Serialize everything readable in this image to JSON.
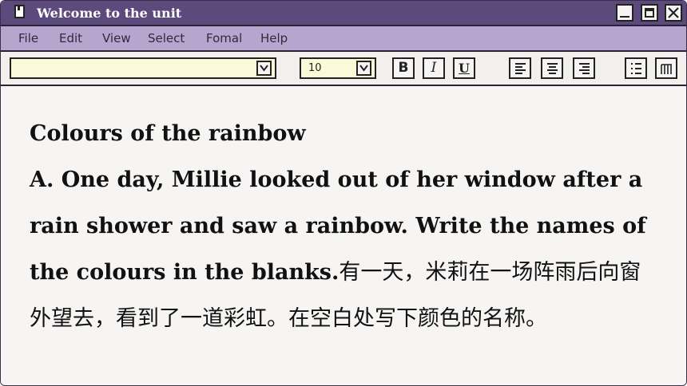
{
  "window": {
    "title": "Welcome to the unit"
  },
  "menubar": {
    "items": [
      "File",
      "Edit",
      "View",
      "Select",
      "Fomal",
      "Help"
    ]
  },
  "toolbar": {
    "font_value": "",
    "size_value": "10",
    "bold_label": "B",
    "italic_label": "I",
    "underline_label": "U"
  },
  "content": {
    "heading": "Colours of the rainbow",
    "paragraph_en": "A. One day, Millie looked out of her window after a rain shower and saw a rainbow. Write the names of the colours in the blanks.",
    "paragraph_cn": "有一天，米莉在一场阵雨后向窗外望去，看到了一道彩虹。在空白处写下颜色的名称。"
  },
  "colors": {
    "titlebar": "#5d4a7c",
    "menubar": "#b6a5cf",
    "field": "#fbfad8"
  }
}
